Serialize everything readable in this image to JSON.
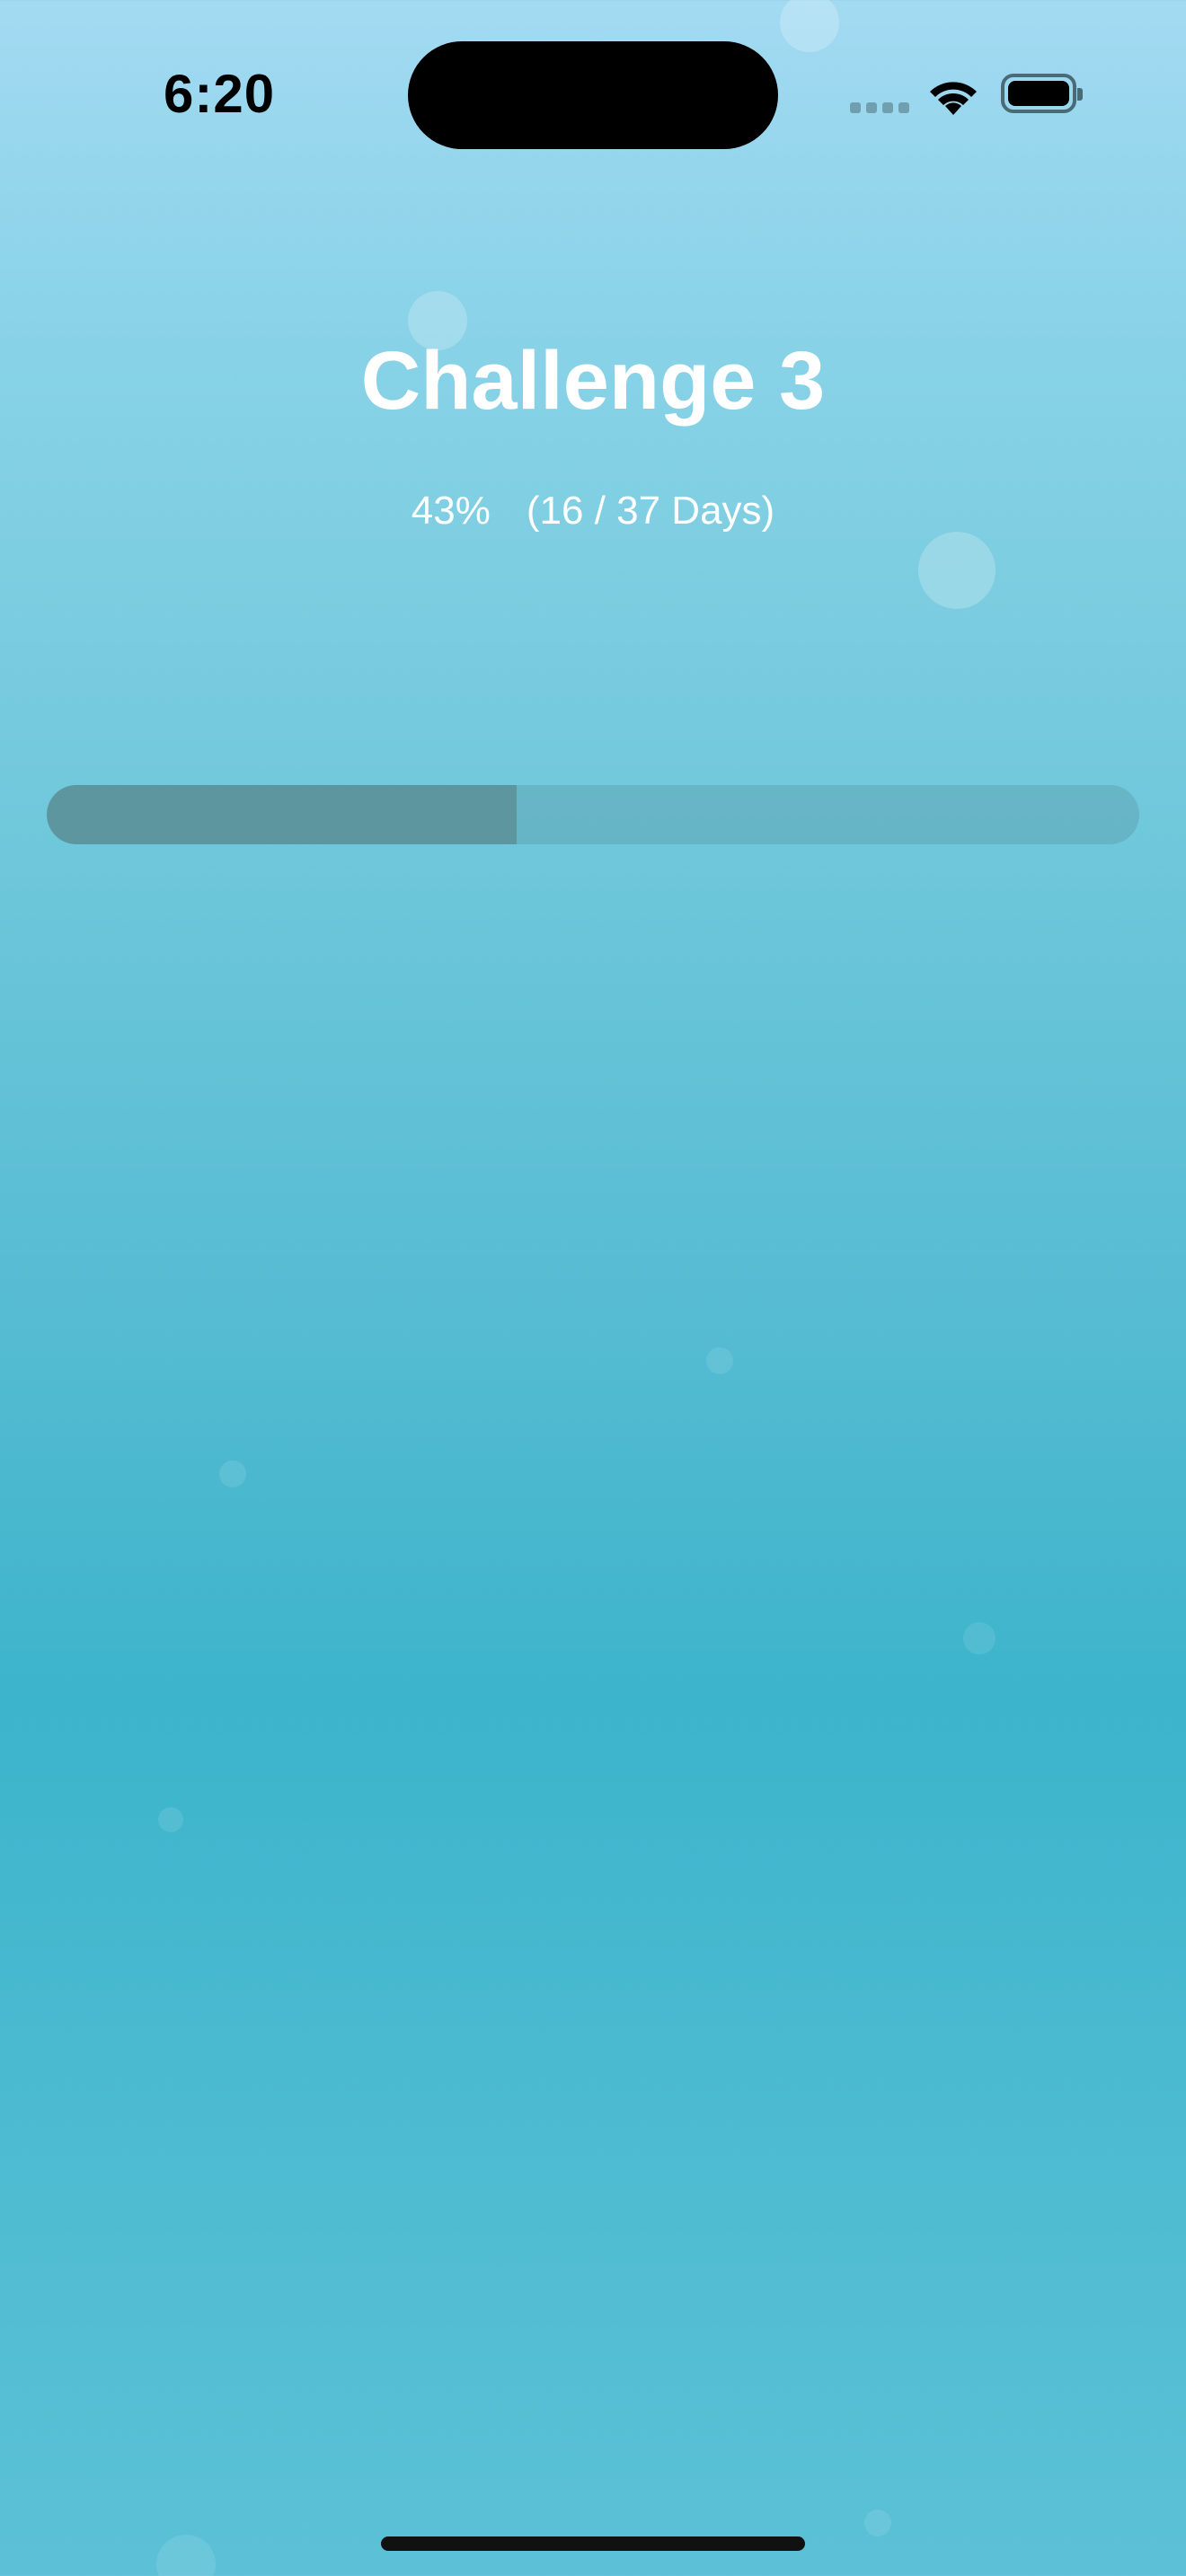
{
  "status_bar": {
    "time": "6:20",
    "icons": [
      "cellular-signal-icon",
      "wifi-icon",
      "battery-icon"
    ]
  },
  "challenge": {
    "title": "Challenge 3",
    "percent_text": "43%",
    "days_text": "(16 / 37 Days)",
    "progress_fraction": 0.43
  },
  "colors": {
    "progress_fill": "#5e969f",
    "background_top": "#a3daf2",
    "background_mid": "#3cb4cb"
  }
}
